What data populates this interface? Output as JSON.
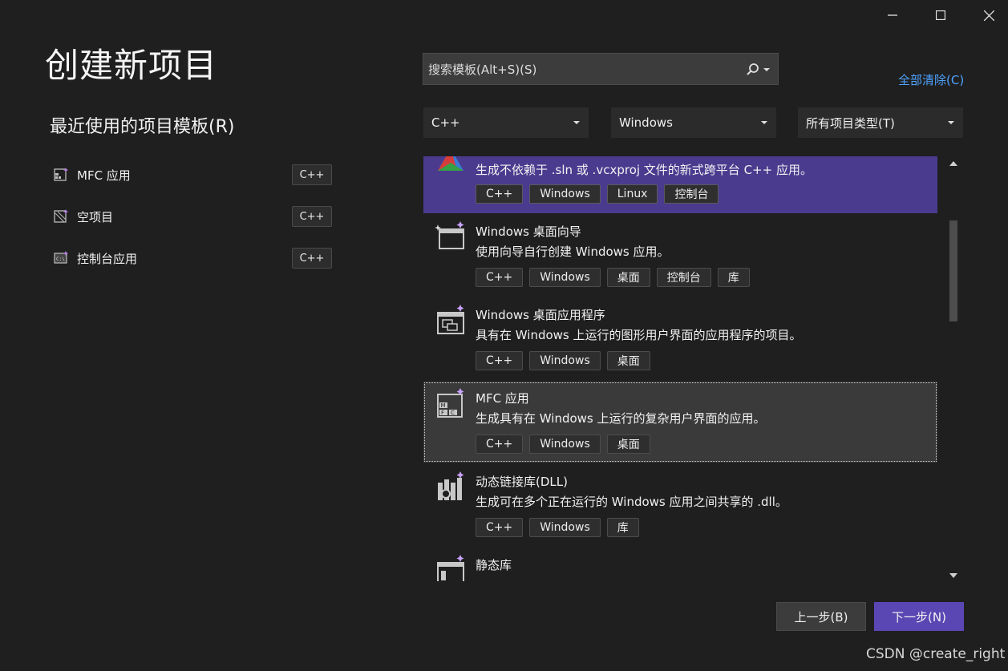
{
  "window_controls": {
    "minimize_icon": "minimize-icon",
    "maximize_icon": "maximize-icon",
    "close_icon": "close-icon"
  },
  "page_title": "创建新项目",
  "recent": {
    "title": "最近使用的项目模板(R)",
    "items": [
      {
        "label": "MFC 应用",
        "tag": "C++",
        "icon": "mfc-icon"
      },
      {
        "label": "空项目",
        "tag": "C++",
        "icon": "empty-project-icon"
      },
      {
        "label": "控制台应用",
        "tag": "C++",
        "icon": "console-icon"
      }
    ]
  },
  "search": {
    "placeholder": "搜索模板(Alt+S)(S)",
    "icon": "search-icon"
  },
  "clear_all": "全部清除(C)",
  "filters": {
    "language": "C++",
    "platform": "Windows",
    "project_type": "所有项目类型(T)"
  },
  "templates": [
    {
      "name": "",
      "desc": "生成不依赖于 .sln 或 .vcxproj 文件的新式跨平台 C++ 应用。",
      "tags": [
        "C++",
        "Windows",
        "Linux",
        "控制台"
      ],
      "icon": "cmake-icon",
      "state": "selected"
    },
    {
      "name": "Windows 桌面向导",
      "desc": "使用向导自行创建 Windows 应用。",
      "tags": [
        "C++",
        "Windows",
        "桌面",
        "控制台",
        "库"
      ],
      "icon": "wizard-icon",
      "state": ""
    },
    {
      "name": "Windows 桌面应用程序",
      "desc": "具有在 Windows 上运行的图形用户界面的应用程序的项目。",
      "tags": [
        "C++",
        "Windows",
        "桌面"
      ],
      "icon": "desktop-app-icon",
      "state": ""
    },
    {
      "name": "MFC 应用",
      "desc": "生成具有在 Windows 上运行的复杂用户界面的应用。",
      "tags": [
        "C++",
        "Windows",
        "桌面"
      ],
      "icon": "mfc-icon",
      "state": "focused"
    },
    {
      "name": "动态链接库(DLL)",
      "desc": "生成可在多个正在运行的 Windows 应用之间共享的 .dll。",
      "tags": [
        "C++",
        "Windows",
        "库"
      ],
      "icon": "dll-icon",
      "state": ""
    },
    {
      "name": "静态库",
      "desc": "",
      "tags": [],
      "icon": "static-lib-icon",
      "state": ""
    }
  ],
  "buttons": {
    "back": "上一步(B)",
    "next": "下一步(N)"
  },
  "watermark": "CSDN @create_right",
  "colors": {
    "background": "#1f1f1f",
    "accent": "#5b47b4",
    "selected_row": "#4a3b8f",
    "link": "#4ea3ff"
  }
}
